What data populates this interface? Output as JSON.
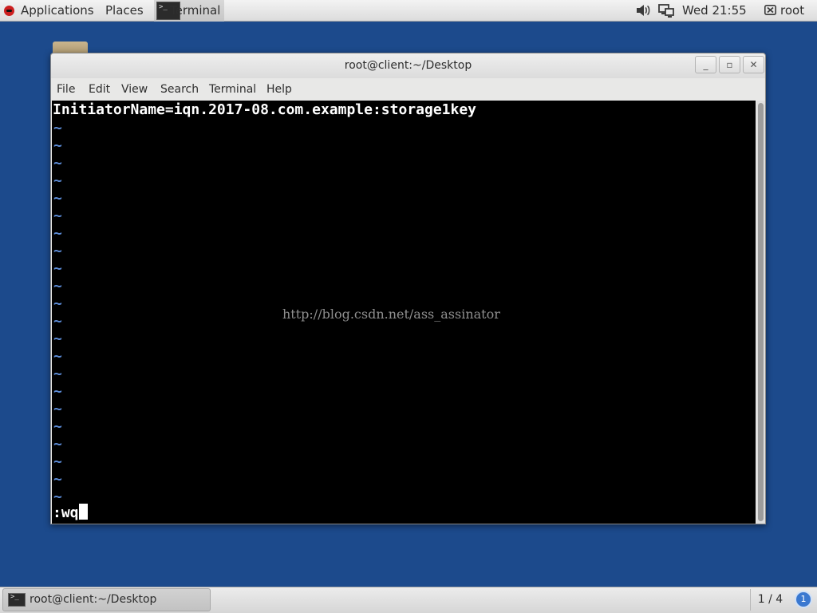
{
  "top_panel": {
    "applications_label": "Applications",
    "places_label": "Places",
    "task_label": "Terminal",
    "clock": "Wed 21:55",
    "user_label": "root"
  },
  "window": {
    "title": "root@client:~/Desktop",
    "menu": [
      "File",
      "Edit",
      "View",
      "Search",
      "Terminal",
      "Help"
    ]
  },
  "terminal": {
    "content_line": "InitiatorName=iqn.2017-08.com.example:storage1key",
    "empty_line_marker": "~",
    "command_line": ":wq",
    "watermark": "http://blog.csdn.net/ass_assinator",
    "colors": {
      "background": "#000000",
      "text": "#ffffff",
      "tilde": "#5c8bd6"
    }
  },
  "bottom_panel": {
    "task_label": "root@client:~/Desktop",
    "workspace": "1 / 4",
    "notification_count": "1"
  },
  "colors": {
    "desktop_background": "#1c4a8c"
  }
}
